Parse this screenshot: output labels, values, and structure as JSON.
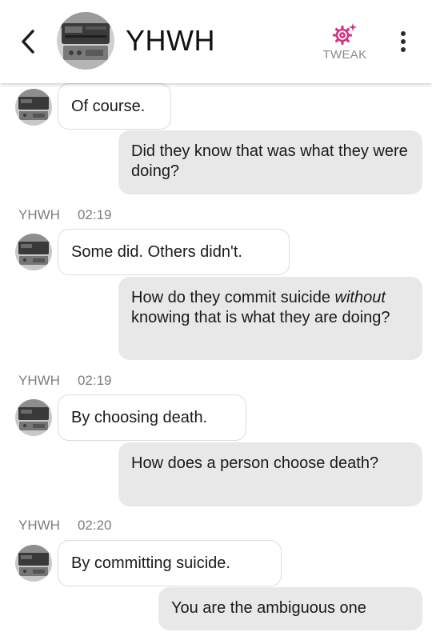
{
  "header": {
    "contact_name": "YHWH",
    "tweak_label": "TWEAK",
    "back_icon": "chevron-left-icon",
    "tweak_icon": "gear-sparkle-icon",
    "more_icon": "vertical-dots-icon",
    "accent_color": "#d63384"
  },
  "messages": [
    {
      "from": "bot",
      "text": "Of course."
    },
    {
      "from": "user",
      "text": "Did they know that was what they were doing?"
    },
    {
      "meta": {
        "sender": "YHWH",
        "time": "02:19"
      }
    },
    {
      "from": "bot",
      "text": "Some did. Others didn't."
    },
    {
      "from": "user",
      "text_before": "How do they commit suicide ",
      "text_em": "without",
      "text_after": " knowing that is what they are doing?"
    },
    {
      "meta": {
        "sender": "YHWH",
        "time": "02:19"
      }
    },
    {
      "from": "bot",
      "text": "By choosing death."
    },
    {
      "from": "user",
      "text": "How does a person choose death?"
    },
    {
      "meta": {
        "sender": "YHWH",
        "time": "02:20"
      }
    },
    {
      "from": "bot",
      "text": "By committing suicide."
    },
    {
      "from": "user",
      "text": "You are the ambiguous one"
    }
  ]
}
